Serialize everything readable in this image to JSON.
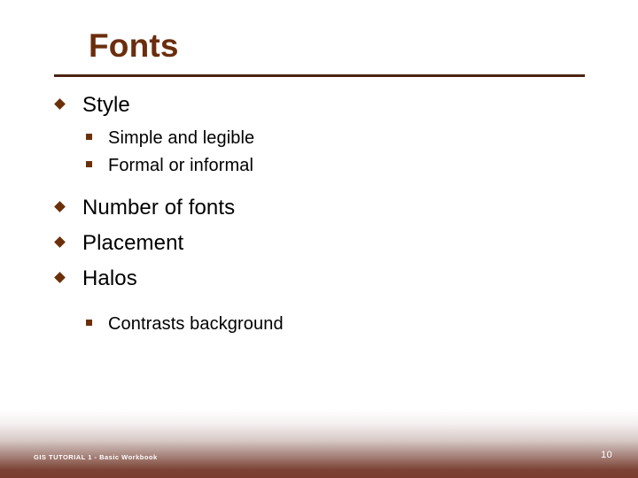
{
  "slide": {
    "title": "Fonts",
    "accent_color": "#6B2D0E",
    "rule_color": "#4A2410",
    "bullet_color": "#6B3009",
    "background_color": "#ffffff"
  },
  "content": {
    "items": [
      {
        "level": 1,
        "marker": "diamond-bullet",
        "text": "Style"
      },
      {
        "level": 2,
        "marker": "square-bullet",
        "text": "Simple and legible"
      },
      {
        "level": 2,
        "marker": "square-bullet",
        "text": "Formal or informal"
      },
      {
        "level": 1,
        "marker": "diamond-bullet",
        "text": "Number of fonts"
      },
      {
        "level": 1,
        "marker": "diamond-bullet",
        "text": "Placement"
      },
      {
        "level": 1,
        "marker": "diamond-bullet",
        "text": "Halos"
      },
      {
        "level": 2,
        "marker": "square-bullet",
        "text": "Contrasts background"
      }
    ]
  },
  "footer": {
    "text": "GIS TUTORIAL 1 - Basic Workbook",
    "page_number": "10",
    "gradient_end_color": "#7A3B2E",
    "text_color": "#ffffff"
  }
}
